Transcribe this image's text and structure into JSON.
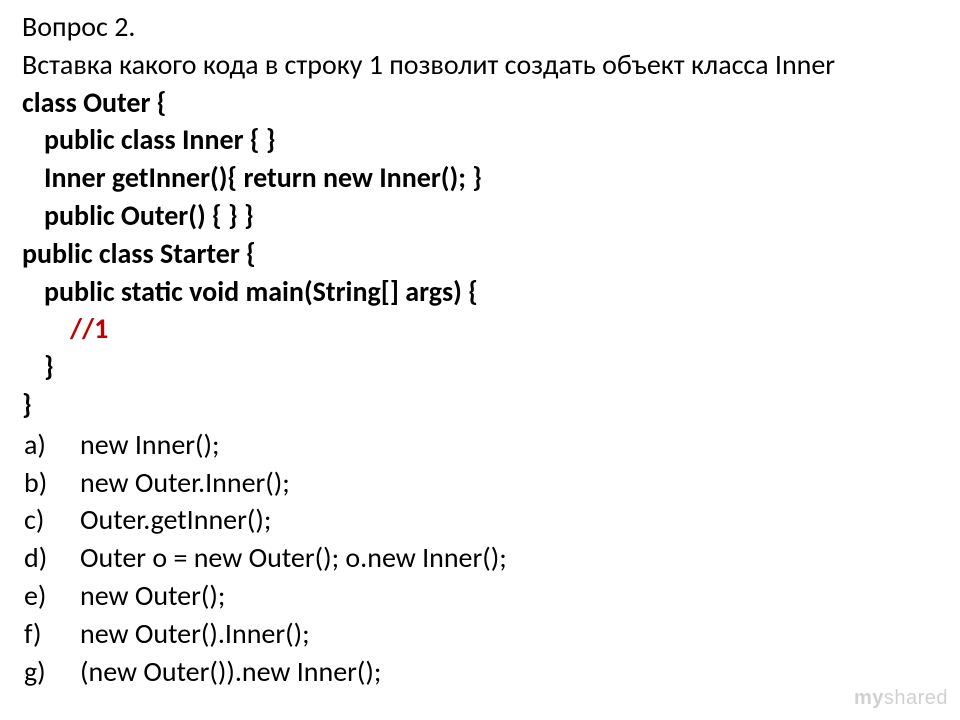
{
  "header": "Вопрос 2.",
  "question": "Вставка какого кода в строку 1 позволит создать объект класса Inner",
  "code": {
    "l1": "class Outer {",
    "l2": "public class Inner { }",
    "l3": "Inner getInner(){ return new Inner(); }",
    "l4": "public Outer() { } }",
    "l5": "public class Starter {",
    "l6": "public static void main(String[] args) {",
    "l7": "//1",
    "l8": "}",
    "l9": "}"
  },
  "options": {
    "a": {
      "marker": "a)",
      "text": "new Inner();"
    },
    "b": {
      "marker": "b)",
      "text": "new Outer.Inner();"
    },
    "c": {
      "marker": "c)",
      "text": "Outer.getInner();"
    },
    "d": {
      "marker": "d)",
      "text": "Outer o = new Outer(); o.new Inner();"
    },
    "e": {
      "marker": "e)",
      "text": "new Outer();"
    },
    "f": {
      "marker": "f)",
      "text": "new Outer().Inner();"
    },
    "g": {
      "marker": "g)",
      "text": "(new Outer()).new Inner();"
    }
  },
  "watermark": {
    "prefix": "my",
    "suffix": "shared"
  }
}
